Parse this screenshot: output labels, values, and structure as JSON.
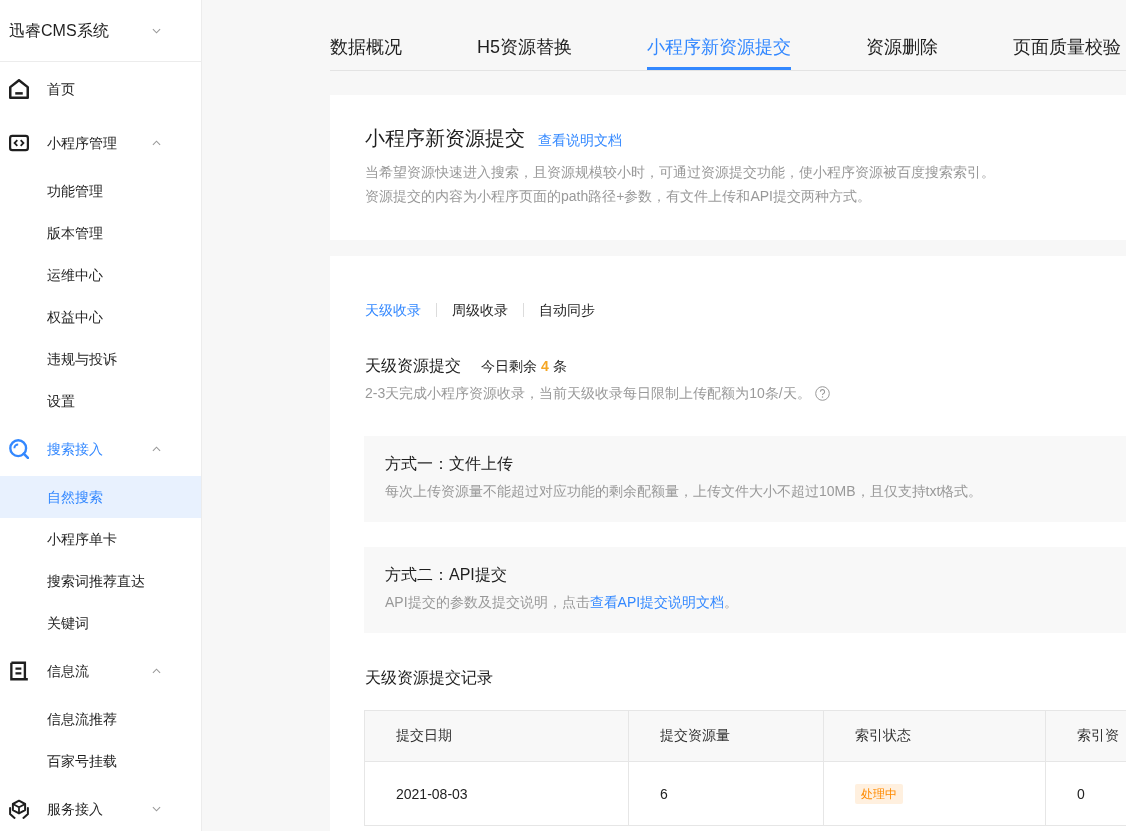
{
  "sidebar": {
    "title": "迅睿CMS系统",
    "items": [
      {
        "label": "首页",
        "selected": false
      },
      {
        "label": "小程序管理",
        "selected": false,
        "expanded": true,
        "children": [
          {
            "label": "功能管理",
            "selected": false
          },
          {
            "label": "版本管理",
            "selected": false
          },
          {
            "label": "运维中心",
            "selected": false
          },
          {
            "label": "权益中心",
            "selected": false
          },
          {
            "label": "违规与投诉",
            "selected": false
          },
          {
            "label": "设置",
            "selected": false
          }
        ]
      },
      {
        "label": "搜索接入",
        "selected": true,
        "expanded": true,
        "children": [
          {
            "label": "自然搜索",
            "selected": true
          },
          {
            "label": "小程序单卡",
            "selected": false
          },
          {
            "label": "搜索词推荐直达",
            "selected": false
          },
          {
            "label": "关键词",
            "selected": false
          }
        ]
      },
      {
        "label": "信息流",
        "selected": false,
        "expanded": true,
        "children": [
          {
            "label": "信息流推荐",
            "selected": false
          },
          {
            "label": "百家号挂载",
            "selected": false
          }
        ]
      },
      {
        "label": "服务接入",
        "selected": false,
        "expanded": false
      }
    ]
  },
  "tabs": [
    {
      "label": "数据概况",
      "selected": false
    },
    {
      "label": "H5资源替换",
      "selected": false
    },
    {
      "label": "小程序新资源提交",
      "selected": true
    },
    {
      "label": "资源删除",
      "selected": false
    },
    {
      "label": "页面质量校验",
      "selected": false
    }
  ],
  "intro": {
    "title": "小程序新资源提交",
    "link": "查看说明文档",
    "lines": [
      "当希望资源快速进入搜索，且资源规模较小时，可通过资源提交功能，使小程序资源被百度搜索索引。",
      "资源提交的内容为小程序页面的path路径+参数，有文件上传和API提交两种方式。"
    ]
  },
  "panel": {
    "subtabs": [
      {
        "label": "天级收录",
        "selected": true
      },
      {
        "label": "周级收录",
        "selected": false
      },
      {
        "label": "自动同步",
        "selected": false
      }
    ],
    "quota": {
      "title": "天级资源提交",
      "prefix": "今日剩余",
      "count": "4",
      "suffix": "条",
      "note": "2-3天完成小程序资源收录，当前天级收录每日限制上传配额为10条/天。"
    },
    "methods": [
      {
        "title": "方式一：文件上传",
        "description": "每次上传资源量不能超过对应功能的剩余配额量，上传文件大小不超过10MB，且仅支持txt格式。"
      },
      {
        "title": "方式二：API提交",
        "description": "API提交的参数及提交说明，点击",
        "link": "查看API提交说明文档",
        "tail": "。"
      }
    ],
    "records": {
      "title": "天级资源提交记录",
      "columns": [
        "提交日期",
        "提交资源量",
        "索引状态",
        "索引资"
      ],
      "rows": [
        {
          "cells": [
            {
              "kind": "text",
              "text": "2021-08-03"
            },
            {
              "kind": "text",
              "text": "6"
            },
            {
              "kind": "badge",
              "text": "处理中"
            },
            {
              "kind": "text",
              "text": "0"
            }
          ]
        }
      ]
    }
  }
}
